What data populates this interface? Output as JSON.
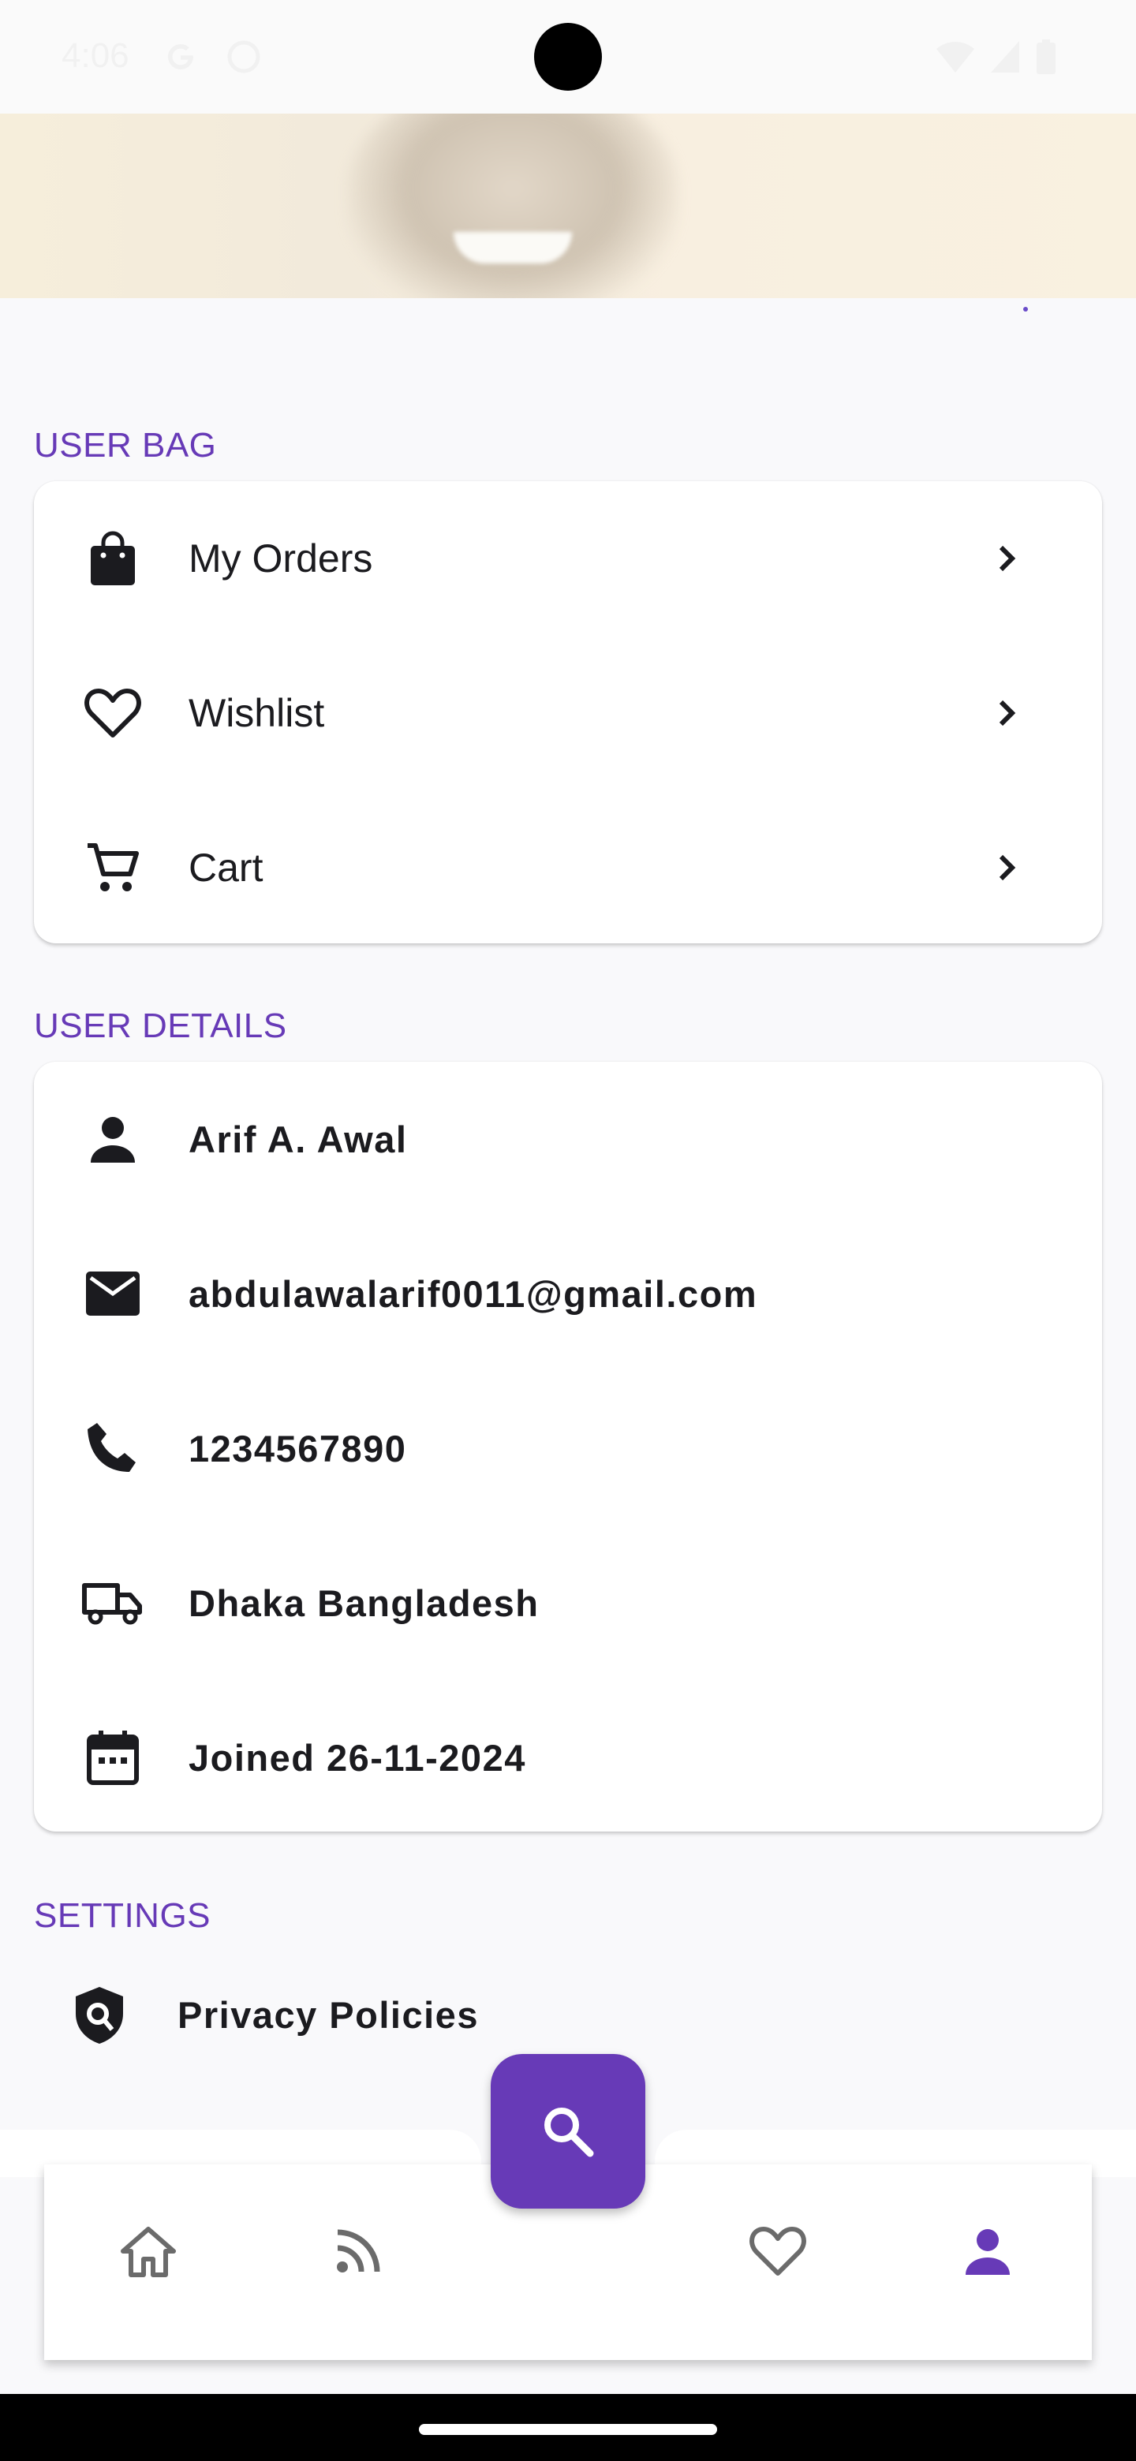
{
  "status_bar": {
    "time": "4:06"
  },
  "sections": {
    "user_bag": "USER BAG",
    "user_details": "USER DETAILS",
    "settings": "SETTINGS"
  },
  "user_bag": {
    "items": [
      {
        "label": "My Orders",
        "icon": "shopping-bag-icon"
      },
      {
        "label": "Wishlist",
        "icon": "heart-outline-icon"
      },
      {
        "label": "Cart",
        "icon": "cart-icon"
      }
    ]
  },
  "user_details": {
    "name": "Arif A. Awal",
    "email": "abdulawalarif0011@gmail.com",
    "phone": "1234567890",
    "address": "Dhaka Bangladesh",
    "joined": "Joined 26-11-2024"
  },
  "settings": {
    "items": [
      {
        "label": "Privacy Policies",
        "icon": "shield-search-icon"
      }
    ]
  },
  "bottom_nav": {
    "items": [
      "home-icon",
      "rss-feed-icon",
      "heart-outline-icon",
      "person-icon"
    ],
    "active": "person-icon",
    "fab_icon": "search-icon"
  },
  "colors": {
    "accent": "#673ab7",
    "text": "#1b1b1f",
    "inactive_nav": "#6b6b6b"
  }
}
